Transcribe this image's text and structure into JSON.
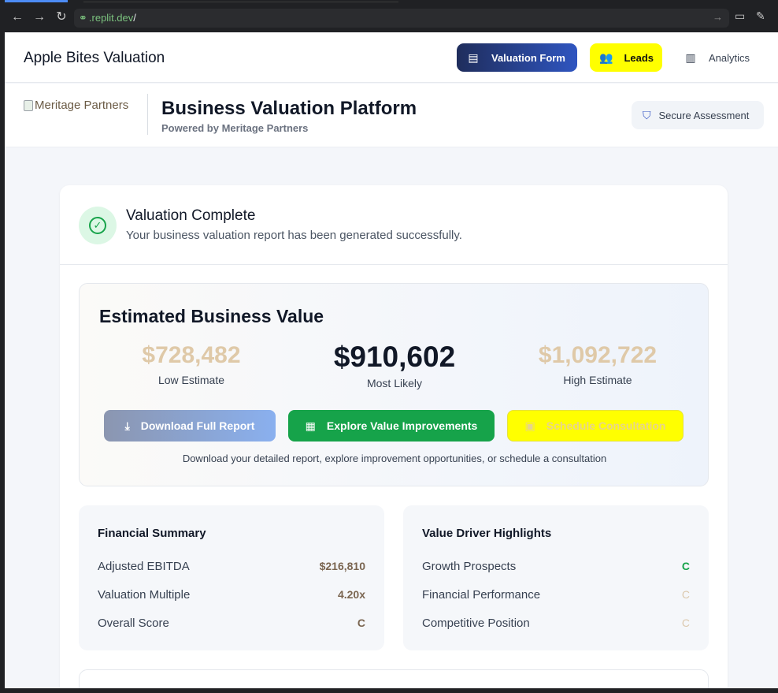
{
  "browser": {
    "url_host": ".replit.dev",
    "url_path": "/"
  },
  "topnav": {
    "brand": "Apple Bites Valuation",
    "valuation_form": "Valuation Form",
    "leads": "Leads",
    "analytics": "Analytics"
  },
  "header": {
    "logo_alt": "Meritage Partners",
    "title": "Business Valuation Platform",
    "subtitle": "Powered by Meritage Partners",
    "secure": "Secure Assessment"
  },
  "complete": {
    "title": "Valuation Complete",
    "subtitle": "Your business valuation report has been generated successfully."
  },
  "estimate": {
    "title": "Estimated Business Value",
    "low_value": "$728,482",
    "low_label": "Low Estimate",
    "mid_value": "$910,602",
    "mid_label": "Most Likely",
    "high_value": "$1,092,722",
    "high_label": "High Estimate",
    "download": "Download Full Report",
    "explore": "Explore Value Improvements",
    "schedule": "Schedule Consultation",
    "help": "Download your detailed report, explore improvement opportunities, or schedule a consultation"
  },
  "financial": {
    "title": "Financial Summary",
    "rows": [
      {
        "label": "Adjusted EBITDA",
        "value": "$216,810"
      },
      {
        "label": "Valuation Multiple",
        "value": "4.20x"
      },
      {
        "label": "Overall Score",
        "value": "C"
      }
    ]
  },
  "drivers": {
    "title": "Value Driver Highlights",
    "rows": [
      {
        "label": "Growth Prospects",
        "value": "C"
      },
      {
        "label": "Financial Performance",
        "value": "C"
      },
      {
        "label": "Competitive Position",
        "value": "C"
      }
    ]
  },
  "colors": {
    "accent_navy": "#1f2d5c",
    "leads_yellow": "#ffff00",
    "success_green": "#16a34a"
  }
}
